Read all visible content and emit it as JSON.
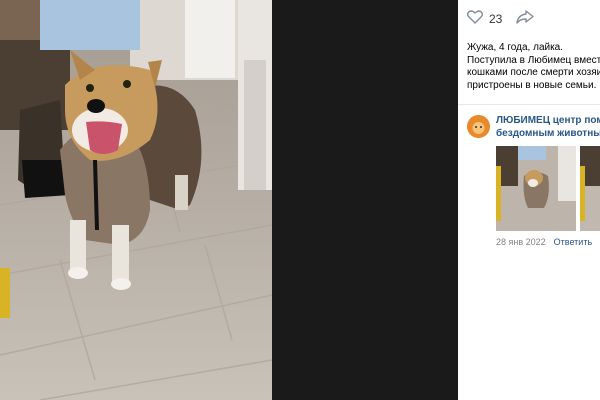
{
  "post": {
    "likes_count": "23",
    "description_lines": [
      "Жужа, 4 года, лайка.",
      "Поступила в Любимец вместе с",
      "кошками после смерти хозяин",
      "пристроены в новые семьи."
    ]
  },
  "comment": {
    "author_lines": [
      "ЛЮБИМЕЦ центр помощ",
      "бездомным животным Т"
    ],
    "date": "28 янв 2022",
    "reply_label": "Ответить"
  },
  "icons": {
    "like": "heart-icon",
    "share": "share-arrow-icon"
  },
  "colors": {
    "link": "#2a5885",
    "meta": "#828282",
    "avatar": "#e8892c"
  }
}
